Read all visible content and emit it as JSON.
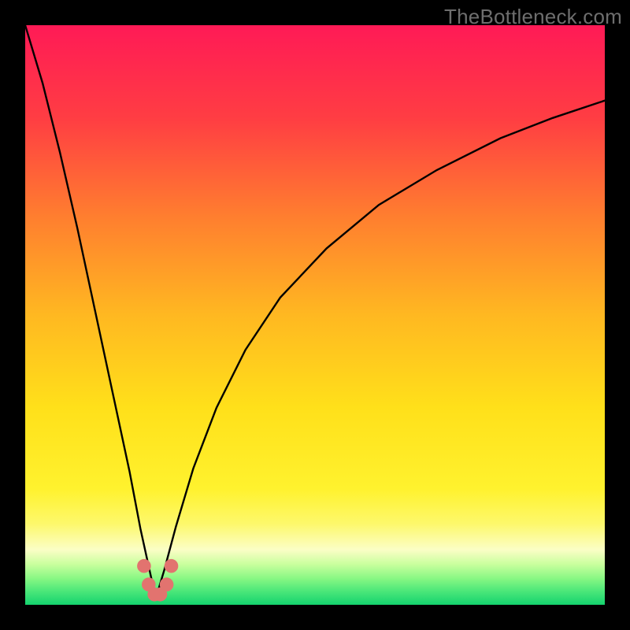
{
  "watermark": "TheBottleneck.com",
  "gradient_stops": [
    {
      "offset": 0,
      "color": "#ff1a56"
    },
    {
      "offset": 0.16,
      "color": "#ff3d43"
    },
    {
      "offset": 0.33,
      "color": "#ff7e2f"
    },
    {
      "offset": 0.5,
      "color": "#ffb821"
    },
    {
      "offset": 0.66,
      "color": "#ffe01a"
    },
    {
      "offset": 0.8,
      "color": "#fff22e"
    },
    {
      "offset": 0.86,
      "color": "#fdf86b"
    },
    {
      "offset": 0.905,
      "color": "#fbfec6"
    },
    {
      "offset": 0.93,
      "color": "#c9ff9e"
    },
    {
      "offset": 0.955,
      "color": "#87f783"
    },
    {
      "offset": 0.975,
      "color": "#4fe87a"
    },
    {
      "offset": 1.0,
      "color": "#14d36e"
    }
  ],
  "chart_data": {
    "type": "line",
    "title": "",
    "xlabel": "",
    "ylabel": "",
    "xlim": [
      0,
      1
    ],
    "ylim": [
      0,
      1
    ],
    "note": "x_min≈0.225; curve is |f(x)| style V reaching y≈0 at x_min; left branch near-vertical from top-left; right branch rises concave to ≈0.87 at x=1.",
    "series": [
      {
        "name": "left-branch",
        "x": [
          0.0,
          0.03,
          0.06,
          0.09,
          0.12,
          0.15,
          0.18,
          0.199,
          0.21,
          0.22,
          0.225
        ],
        "y": [
          1.0,
          0.9,
          0.78,
          0.65,
          0.51,
          0.37,
          0.23,
          0.13,
          0.08,
          0.035,
          0.01
        ]
      },
      {
        "name": "right-branch",
        "x": [
          0.225,
          0.24,
          0.26,
          0.29,
          0.33,
          0.38,
          0.44,
          0.52,
          0.61,
          0.71,
          0.82,
          0.91,
          1.0
        ],
        "y": [
          0.01,
          0.06,
          0.135,
          0.235,
          0.34,
          0.44,
          0.53,
          0.615,
          0.69,
          0.75,
          0.805,
          0.84,
          0.87
        ]
      }
    ],
    "trough_markers": {
      "color": "#e2736f",
      "radius_norm": 0.012,
      "points_x": [
        0.205,
        0.213,
        0.223,
        0.233,
        0.244,
        0.252
      ],
      "points_y": [
        0.067,
        0.035,
        0.018,
        0.018,
        0.035,
        0.067
      ]
    }
  }
}
